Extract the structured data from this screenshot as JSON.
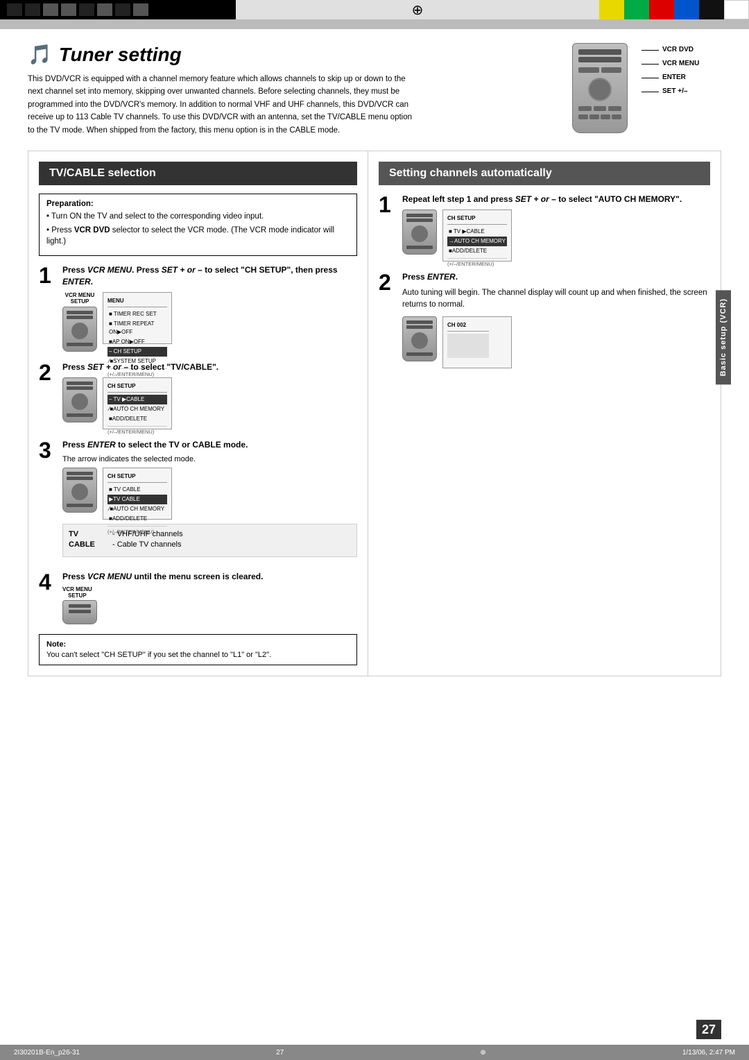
{
  "topBar": {
    "colors": [
      "#e8d800",
      "#00b050",
      "#ff0000",
      "#0070c0",
      "#000000",
      "#ffffff",
      "#e8d800",
      "#00b050",
      "#ff0000",
      "#0070c0"
    ]
  },
  "page": {
    "title": "Tuner setting",
    "pageNumber": "27",
    "description": "This DVD/VCR is equipped with a channel memory feature which allows channels to skip up or down to the next channel set into memory, skipping over unwanted channels. Before selecting channels, they must be programmed into the DVD/VCR's memory. In addition to normal VHF and UHF channels, this DVD/VCR can receive up to 113 Cable TV channels. To use this DVD/VCR with an antenna, set the TV/CABLE menu option to the TV mode. When shipped from the factory, this menu option is in the CABLE mode.",
    "remoteLabels": [
      "VCR DVD",
      "VCR MENU",
      "ENTER",
      "SET +/–"
    ],
    "leftSection": {
      "title": "TV/CABLE selection",
      "preparation": {
        "title": "Preparation:",
        "items": [
          "Turn ON the TV and select to the corresponding video input.",
          "Press VCR DVD selector to select the VCR mode. (The VCR mode indicator will light.)"
        ]
      },
      "steps": [
        {
          "num": "1",
          "title": "Press VCR MENU. Press SET + or – to select \"CH SETUP\", then press ENTER.",
          "vcrLabel": "VCR MENU\nSETUP",
          "screen": {
            "header": "MENU",
            "items": [
              "■ TIMER REC SET",
              "■ TIMER REPEAT  ON ▶OFF",
              "■AP            ON ▶OFF",
              "– CH SETUP",
              "⁄■SYSTEM SETUP"
            ],
            "selectedIndex": 3,
            "footer": "(+/–/ENTER/MENU)"
          }
        },
        {
          "num": "2",
          "title": "Press SET + or – to select \"TV/CABLE\".",
          "screen": {
            "header": "CH SETUP",
            "items": [
              "–  TV ▶CABLE",
              "⁄■AUTO CH MEMORY",
              "■ADD/DELETE"
            ],
            "selectedIndex": 0,
            "footer": "(+/–/ENTER/MENU)"
          }
        },
        {
          "num": "3",
          "title": "Press ENTER to select the TV or CABLE mode.",
          "note": "The arrow indicates the selected mode.",
          "screen": {
            "header": "CH SETUP",
            "items": [
              "■ TV  CABLE",
              "▶TV  CABLE",
              "⁄■AUTO CH MEMORY",
              "■ADD/DELETE"
            ],
            "selectedIndex": 1,
            "footer": "(+/–/ENTER/MENU)"
          },
          "tvCable": {
            "tv": "TV    - VHF/UHF channels",
            "cable": "CABLE - Cable TV channels"
          }
        },
        {
          "num": "4",
          "title": "Press VCR MENU until the menu screen is cleared.",
          "vcrLabel": "VCR MENU\nSETUP"
        }
      ],
      "note": {
        "title": "Note:",
        "text": "You can't select \"CH SETUP\" if you set the channel to \"L1\" or \"L2\"."
      }
    },
    "rightSection": {
      "title": "Setting channels automatically",
      "sidebarLabel": "Basic setup (VCR)",
      "steps": [
        {
          "num": "1",
          "title": "Repeat left step 1 and press SET + or – to select \"AUTO CH MEMORY\".",
          "screen": {
            "header": "CH SETUP",
            "items": [
              "■ TV ▶CABLE",
              "→AUTO CH MEMORY",
              "■ADD/DELETE"
            ],
            "selectedIndex": 1,
            "footer": "(+/–/ENTER/MENU)"
          }
        },
        {
          "num": "2",
          "title": "Press ENTER.",
          "body": "Auto tuning will begin. The channel display will count up and when finished, the screen returns to normal.",
          "screen": {
            "header": "CH 002",
            "items": [],
            "footer": ""
          }
        }
      ]
    },
    "footer": {
      "left": "2I30201B-En_p26-31",
      "center": "27",
      "right": "1/13/06, 2:47 PM"
    }
  }
}
